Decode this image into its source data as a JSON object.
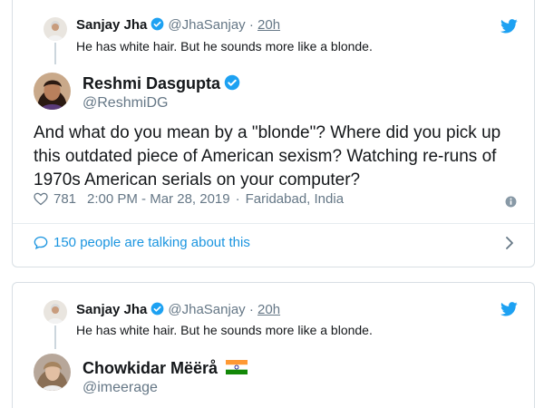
{
  "colors": {
    "accent": "#1da1f2",
    "link": "#1b95e0",
    "muted": "#657786",
    "border": "#d8dfe4"
  },
  "card1": {
    "quoted": {
      "name": "Sanjay Jha",
      "handle": "@JhaSanjay",
      "separator": "·",
      "time": "20h",
      "text": "He has white hair. But he sounds more like a blonde."
    },
    "author": {
      "name": "Reshmi Dasgupta",
      "handle": "@ReshmiDG"
    },
    "body": "And what do you mean by a \"blonde\"? Where did you pick up this outdated piece of American sexism? Watching re-runs of 1970s American serials on your computer?",
    "likes": "781",
    "timestamp": "2:00 PM - Mar 28, 2019",
    "location_prefix": "·",
    "location": "Faridabad, India",
    "talk_text": "150 people are talking about this",
    "icons": {
      "bird": "twitter-bird-icon",
      "heart": "heart-icon",
      "info": "info-icon",
      "bubble": "comment-bubble-icon",
      "chevron": "chevron-right-icon",
      "verified": "verified-badge-icon"
    }
  },
  "card2": {
    "quoted": {
      "name": "Sanjay Jha",
      "handle": "@JhaSanjay",
      "separator": "·",
      "time": "20h",
      "text": "He has white hair. But he sounds more like a blonde."
    },
    "author": {
      "name": "Chowkidar Mëërå",
      "handle": "@imeerage"
    },
    "icons": {
      "flag": "india-flag-icon"
    }
  }
}
